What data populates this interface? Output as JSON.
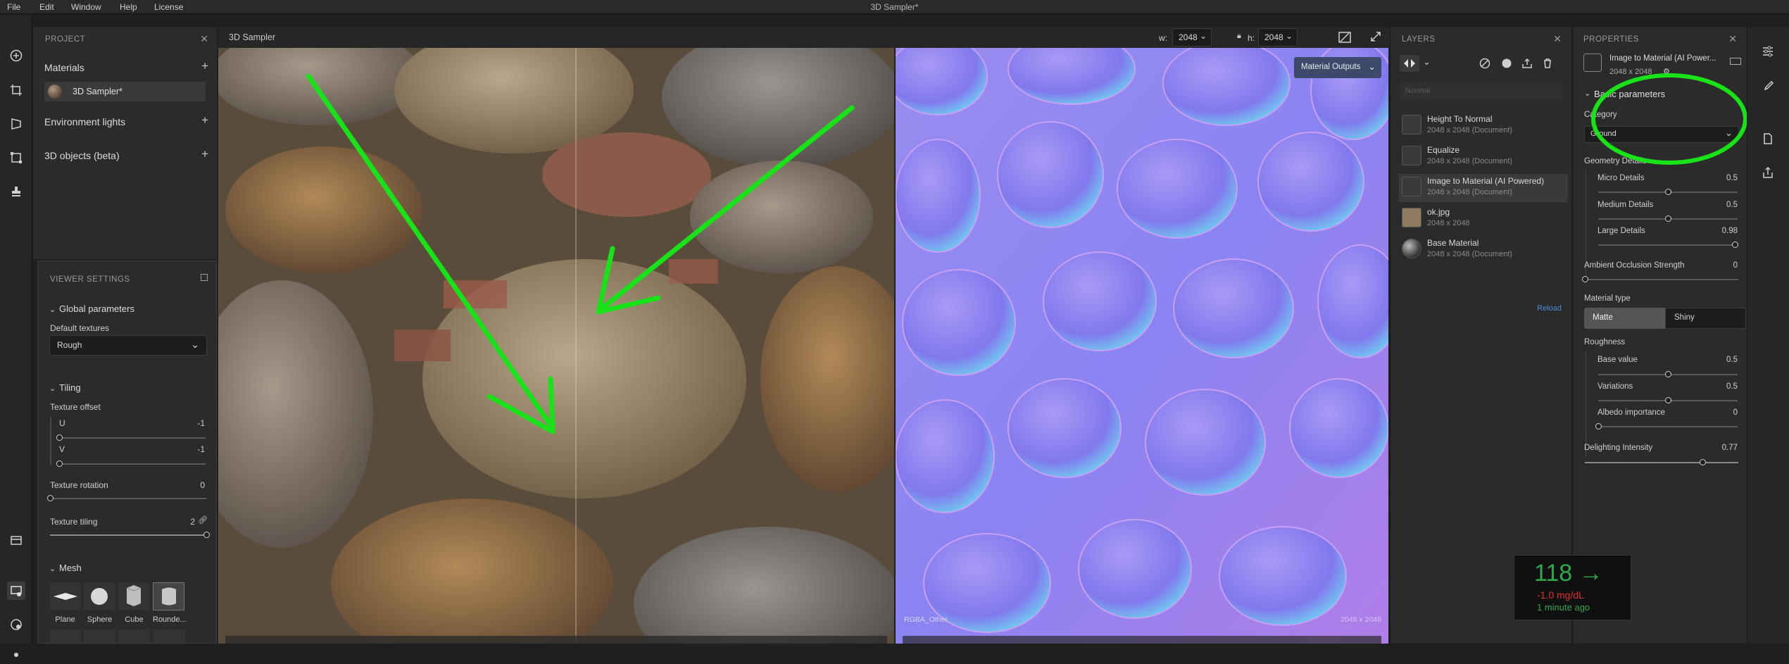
{
  "menu": [
    "File",
    "Edit",
    "Window",
    "Help",
    "License"
  ],
  "app_title": "3D Sampler*",
  "project": {
    "title": "PROJECT",
    "materials_label": "Materials",
    "material_item": "3D Sampler*",
    "env_lights_label": "Environment lights",
    "objects_label": "3D objects (beta)"
  },
  "viewer_settings": {
    "title": "VIEWER SETTINGS",
    "global_params": "Global parameters",
    "default_textures_label": "Default textures",
    "default_textures_value": "Rough",
    "tiling": "Tiling",
    "texture_offset": "Texture offset",
    "u_label": "U",
    "u_value": "-1",
    "v_label": "V",
    "v_value": "-1",
    "rotation_label": "Texture rotation",
    "rotation_value": "0",
    "tiling_label": "Texture tiling",
    "tiling_value": "2",
    "mesh": "Mesh",
    "meshes": [
      "Plane",
      "Sphere",
      "Cube",
      "Rounde..."
    ]
  },
  "document": {
    "tab_label": "3D Sampler",
    "w_label": "w:",
    "w_value": "2048",
    "h_label": "h:",
    "h_value": "2048",
    "material_outputs": "Material Outputs",
    "channel_label": "RGBA_Other",
    "size_label": "2048 x 2048"
  },
  "layers": {
    "title": "LAYERS",
    "blend_placeholder": "Normal",
    "items": [
      {
        "name": "Height To Normal",
        "sub": "2048 x 2048 (Document)"
      },
      {
        "name": "Equalize",
        "sub": "2048 x 2048 (Document)"
      },
      {
        "name": "Image to Material (AI Powered)",
        "sub": "2048 x 2048 (Document)"
      },
      {
        "name": "ok.jpg",
        "sub": "2048 x 2048"
      },
      {
        "name": "Base Material",
        "sub": "2048 x 2048 (Document)"
      }
    ],
    "reload": "Reload"
  },
  "properties": {
    "title": "PROPERTIES",
    "layer_name": "Image to Material (AI Power...",
    "layer_size": "2048 x 2048",
    "basic_params": "Basic parameters",
    "category_label": "Category",
    "category_value": "Ground",
    "geometry_details": "Geometry Details",
    "micro_label": "Micro Details",
    "micro_value": "0.5",
    "micro_fraction": 0.5,
    "medium_label": "Medium Details",
    "medium_value": "0.5",
    "medium_fraction": 0.5,
    "large_label": "Large Details",
    "large_value": "0.98",
    "large_fraction": 0.98,
    "ao_label": "Ambient Occlusion Strength",
    "ao_value": "0",
    "ao_fraction": 0,
    "material_type": "Material type",
    "matte": "Matte",
    "shiny": "Shiny",
    "roughness": "Roughness",
    "base_label": "Base value",
    "base_value": "0.5",
    "base_fraction": 0.5,
    "variations_label": "Variations",
    "variations_value": "0.5",
    "variations_fraction": 0.5,
    "albedo_label": "Albedo importance",
    "albedo_value": "0",
    "albedo_fraction": 0,
    "delighting_label": "Delighting Intensity",
    "delighting_value": "0.77",
    "delighting_fraction": 0.77
  },
  "glucose": {
    "value": "118 →",
    "delta": "-1.0 mg/dL",
    "time": "1 minute ago"
  },
  "colors": {
    "annotation_green": "#18e218",
    "accent_blue": "#4a8fd9",
    "glucose_green": "#2ea84a",
    "glucose_red": "#e03030"
  }
}
